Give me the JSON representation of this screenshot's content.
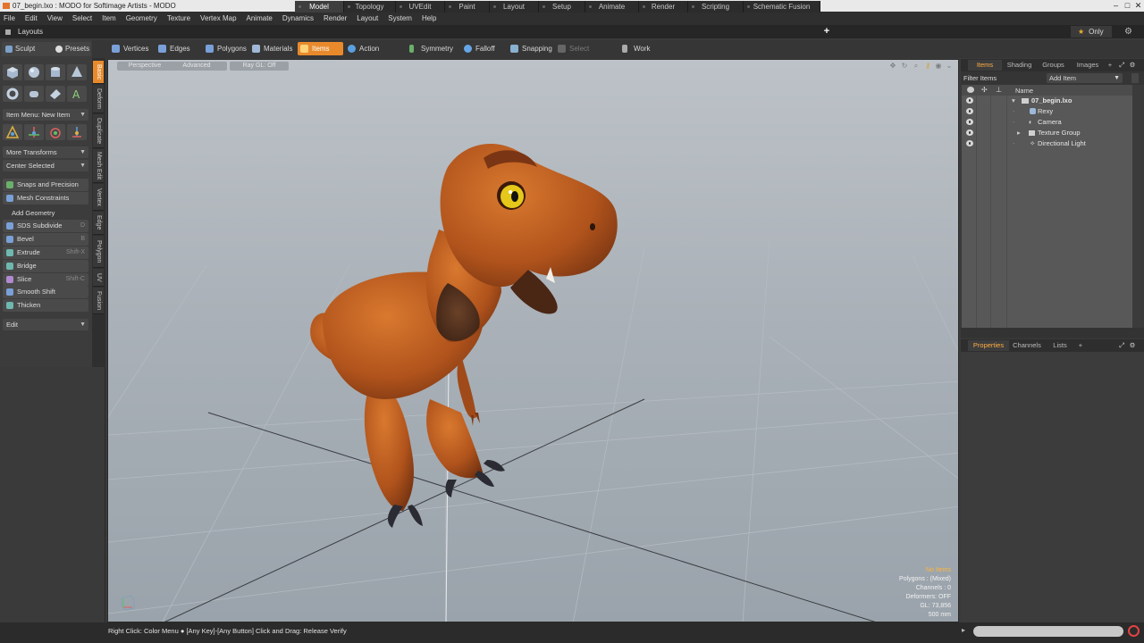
{
  "window": {
    "title": "07_begin.lxo : MODO for Softimage Artists - MODO"
  },
  "menu": [
    "File",
    "Edit",
    "View",
    "Select",
    "Item",
    "Geometry",
    "Texture",
    "Vertex Map",
    "Animate",
    "Dynamics",
    "Render",
    "Layout",
    "System",
    "Help"
  ],
  "layoutbar": {
    "layouts_label": "Layouts",
    "tabs": [
      "Model",
      "Topology",
      "UVEdit",
      "Paint",
      "Layout",
      "Setup",
      "Animate",
      "Render",
      "Scripting",
      "Schematic Fusion"
    ],
    "active_tab": "Model",
    "add_label": "+",
    "only_label": "Only"
  },
  "toolbar": {
    "sculpt": "Sculpt",
    "presets": "Presets",
    "items": [
      {
        "label": "Vertices",
        "color": "#7aa0d8"
      },
      {
        "label": "Edges",
        "color": "#7aa0d8"
      },
      {
        "label": "Polygons",
        "color": "#7aa0d8"
      },
      {
        "label": "Materials",
        "color": "#9fb8d8"
      },
      {
        "label": "Items",
        "color": "#ffd27a"
      },
      {
        "label": "Action Center",
        "color": "#5aa0e0"
      },
      {
        "label": "Symmetry",
        "color": "#6ab06a"
      },
      {
        "label": "Falloff",
        "color": "#66a6e6"
      },
      {
        "label": "Snapping",
        "color": "#8ab0d0"
      },
      {
        "label": "Select Through",
        "color": "#777"
      },
      {
        "label": "Work Plane",
        "color": "#aaa"
      }
    ],
    "selected": "Items"
  },
  "left_panel": {
    "item_menu": "Item Menu: New Item",
    "more_transforms": "More Transforms",
    "center_selected": "Center Selected",
    "snaps": "Snaps and Precision",
    "mesh_constraints": "Mesh Constraints",
    "add_geometry": "Add Geometry",
    "tools": [
      {
        "label": "SDS Subdivide",
        "key": "D"
      },
      {
        "label": "Bevel",
        "key": "B"
      },
      {
        "label": "Extrude",
        "key": "Shift-X"
      },
      {
        "label": "Bridge",
        "key": ""
      },
      {
        "label": "Slice",
        "key": "Shift-C"
      },
      {
        "label": "Smooth Shift",
        "key": ""
      },
      {
        "label": "Thicken",
        "key": ""
      }
    ],
    "edit_dropdown": "Edit",
    "vertical_tabs": [
      "Basic",
      "Deform",
      "Duplicate",
      "Mesh Edit",
      "Vertex",
      "Edge",
      "Polygon",
      "UV",
      "Fusion"
    ]
  },
  "viewport": {
    "buttons": [
      "Perspective",
      "Advanced",
      "Ray GL: Off"
    ],
    "stats": [
      "No Items",
      "Polygons : (Mixed)",
      "Channels : 0",
      "Deformers: OFF",
      "GL: 73,856",
      "500 mm"
    ]
  },
  "items_panel": {
    "tabs": [
      "Items",
      "Shading",
      "Groups",
      "Images"
    ],
    "active_tab": "Items",
    "filter_label": "Filter Items",
    "add_item_label": "Add Item",
    "column_name": "Name",
    "tree": [
      {
        "label": "07_begin.lxo",
        "icon": "scene-icon"
      },
      {
        "label": "Rexy",
        "icon": "mesh-icon"
      },
      {
        "label": "Camera",
        "icon": "camera-icon"
      },
      {
        "label": "Texture Group",
        "icon": "group-icon"
      },
      {
        "label": "Directional Light",
        "icon": "light-icon"
      }
    ]
  },
  "properties_panel": {
    "tabs": [
      "Properties",
      "Channels",
      "Lists"
    ],
    "active_tab": "Properties",
    "add_label": "+"
  },
  "statusbar": {
    "text": "Right Click: Color Menu ● [Any Key]-[Any Button] Click and Drag: Release Verify"
  },
  "colors": {
    "accent": "#e88a2c",
    "viewport_top": "#bcc2c7",
    "viewport_bottom": "#9aa3ab",
    "creature_main": "#b0531c",
    "eye_yellow": "#e6c81a"
  }
}
